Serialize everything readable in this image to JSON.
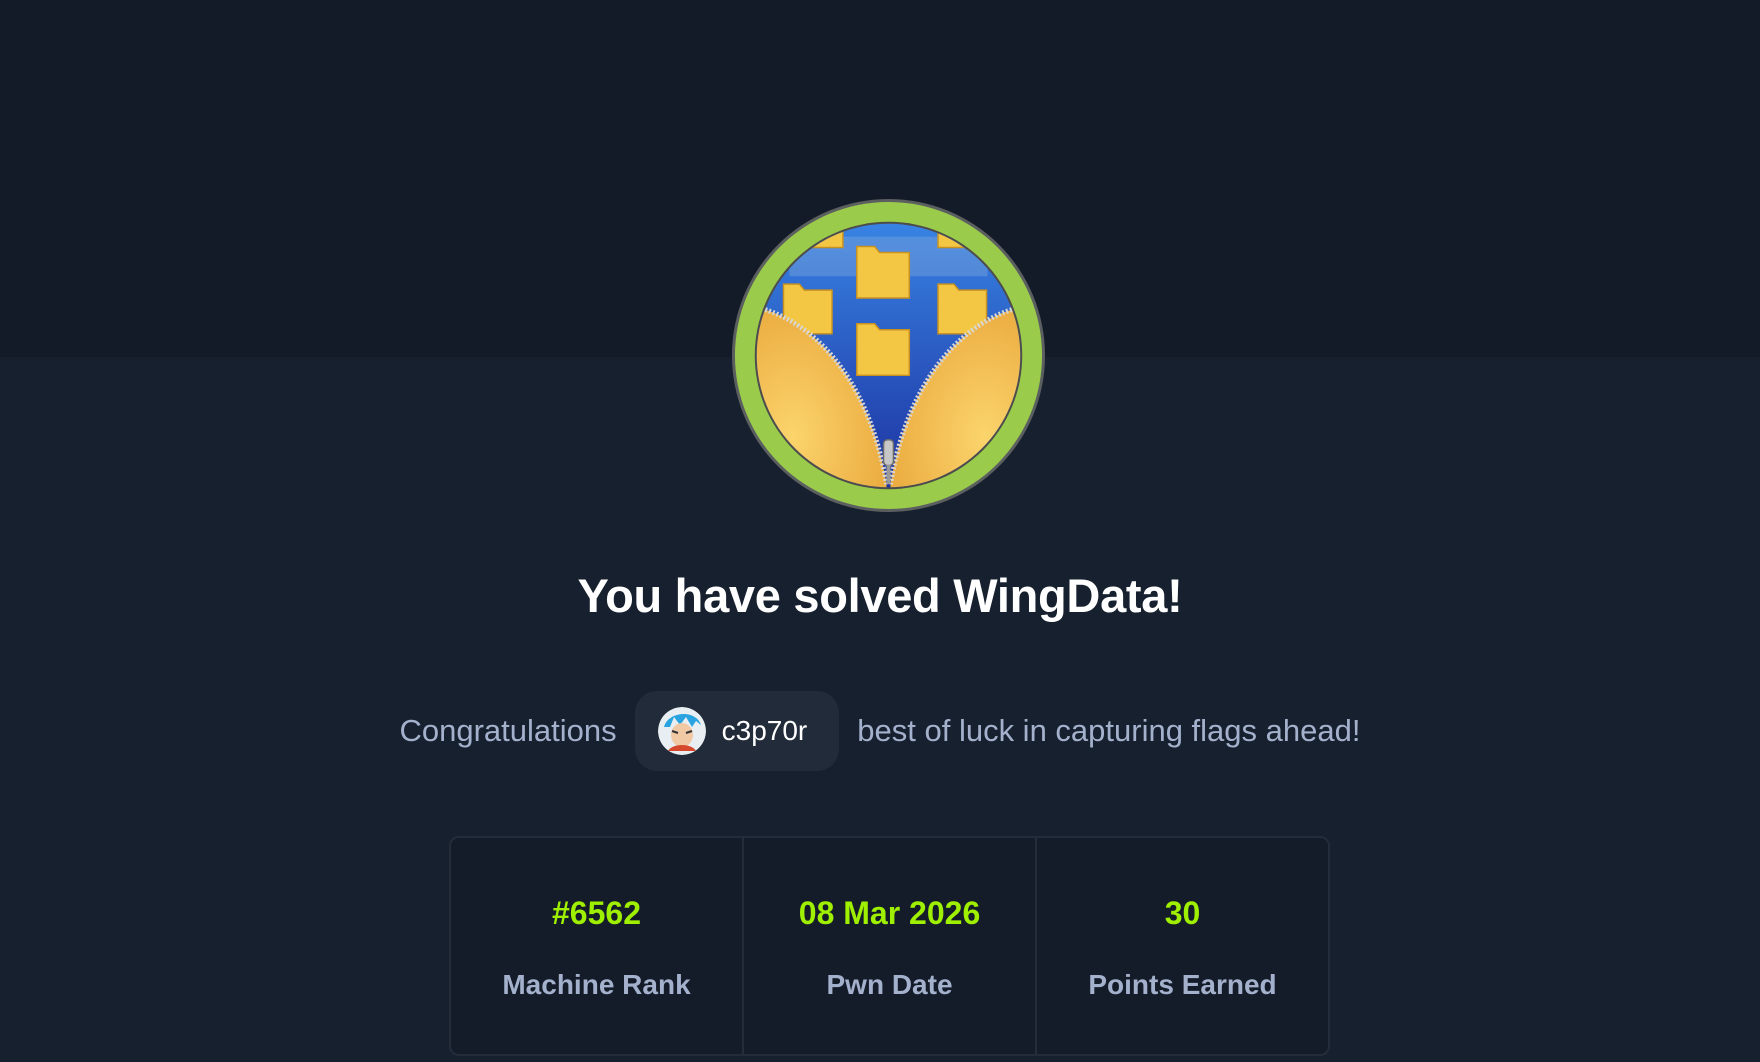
{
  "header": {
    "title": "You have solved WingData!",
    "badge_icon": "zipper-folders-icon"
  },
  "congrats": {
    "prefix": "Congratulations",
    "username": "c3p70r",
    "suffix": "best of luck in capturing flags ahead!"
  },
  "stats": [
    {
      "value": "#6562",
      "label": "Machine Rank"
    },
    {
      "value": "08 Mar 2026",
      "label": "Pwn Date"
    },
    {
      "value": "30",
      "label": "Points Earned"
    }
  ],
  "colors": {
    "accent": "#9fef00",
    "badge_ring": "#9acb4a",
    "text_muted": "#a4b1cd",
    "background": "#17202e"
  }
}
